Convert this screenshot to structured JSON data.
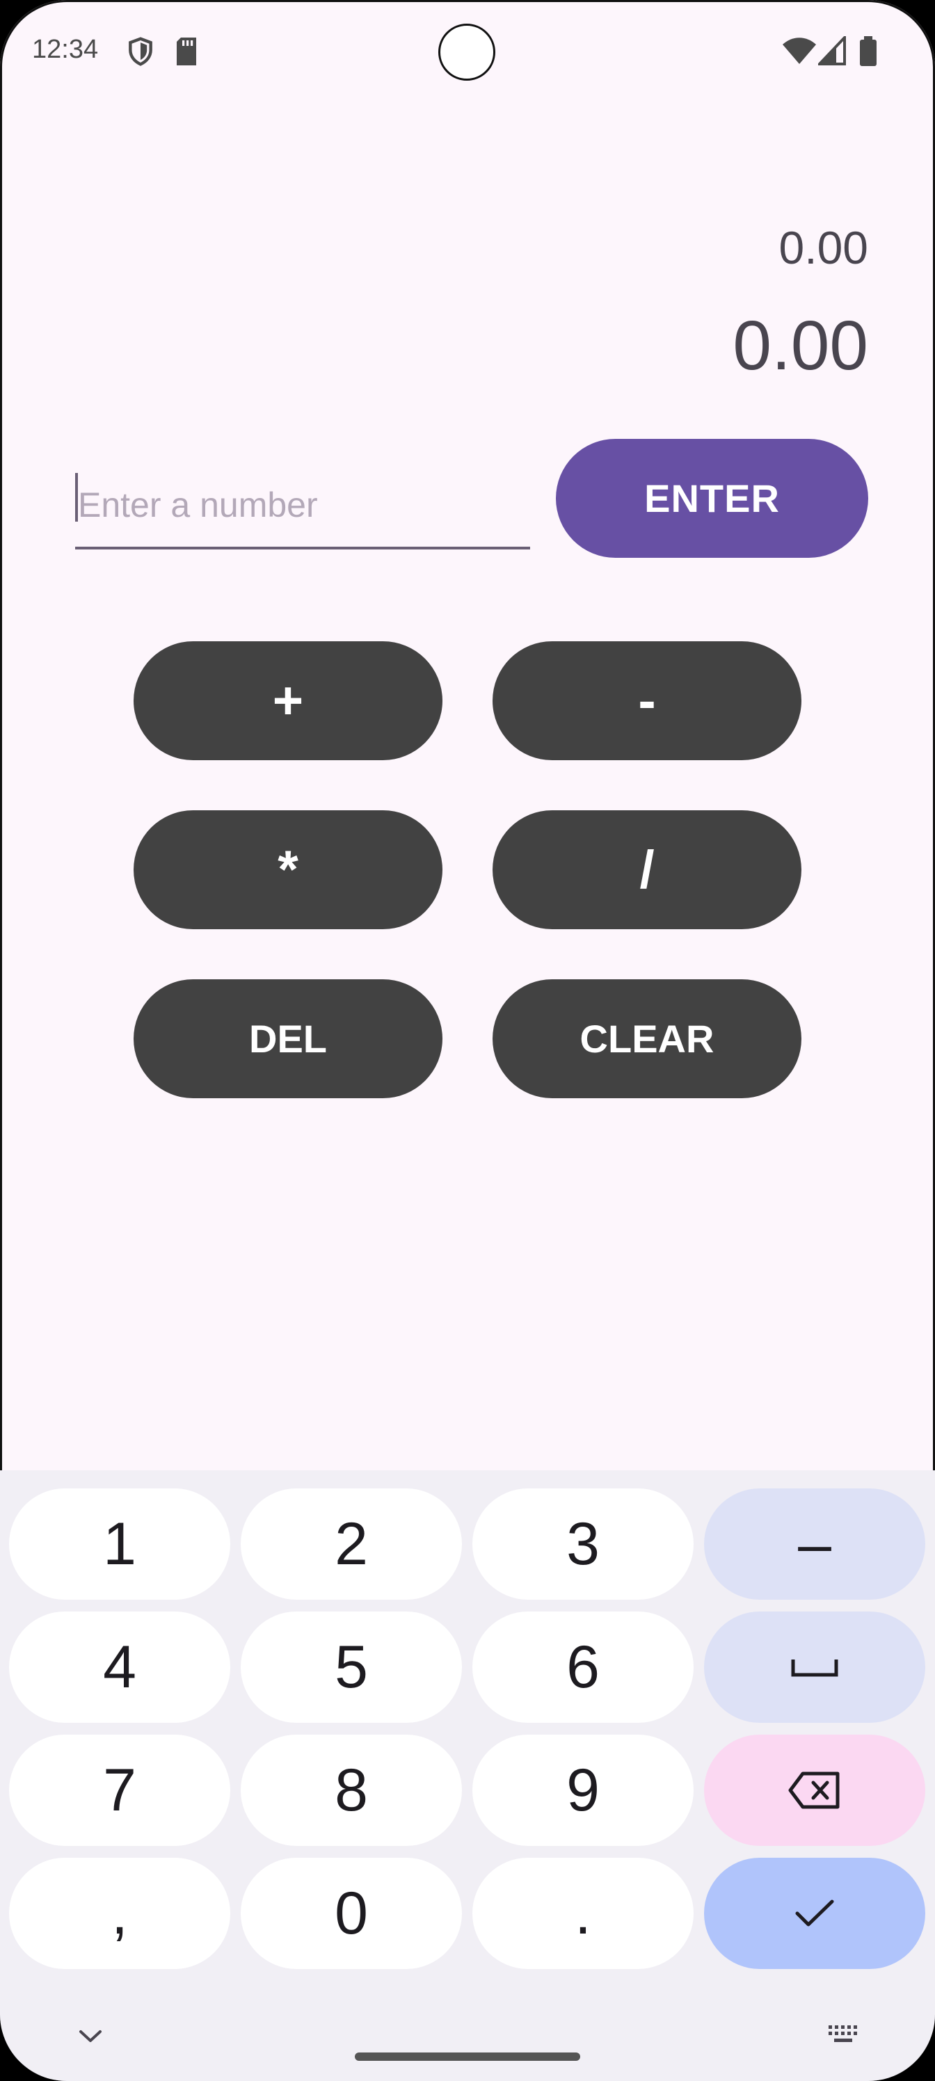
{
  "status_bar": {
    "time": "12:34"
  },
  "display": {
    "secondary_value": "0.00",
    "main_value": "0.00"
  },
  "input": {
    "value": "",
    "placeholder": "Enter a number"
  },
  "buttons": {
    "enter": "ENTER",
    "plus": "+",
    "minus": "-",
    "multiply": "*",
    "divide": "/",
    "del": "DEL",
    "clear": "CLEAR"
  },
  "keyboard": {
    "keys": [
      "1",
      "2",
      "3",
      "–",
      "4",
      "5",
      "6",
      "7",
      "8",
      "9",
      ",",
      "0",
      "."
    ]
  },
  "colors": {
    "accent": "#6750a4",
    "op_button": "#424242",
    "background": "#fdf6fc"
  }
}
